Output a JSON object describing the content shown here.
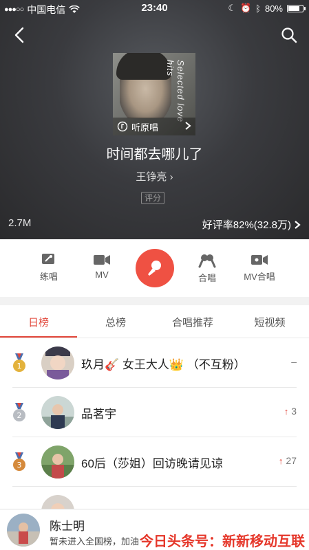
{
  "status_bar": {
    "signal": "●●●○○",
    "carrier": "中国电信",
    "time": "23:40",
    "battery": "80%"
  },
  "song": {
    "cover_caption": "听原唱",
    "cover_text": "Selected love hits",
    "title": "时间都去哪儿了",
    "artist": "王铮亮 ›",
    "rate_tag": "评分",
    "listen_count": "2.7M",
    "good_rate": "好评率82%(32.8万)"
  },
  "actions": [
    {
      "label": "练唱",
      "icon": "practice-icon"
    },
    {
      "label": "MV",
      "icon": "video-camera-icon"
    },
    {
      "label": "",
      "icon": "microphone-icon"
    },
    {
      "label": "合唱",
      "icon": "duet-icon"
    },
    {
      "label": "MV合唱",
      "icon": "mv-duet-icon"
    }
  ],
  "tabs": [
    {
      "label": "日榜",
      "active": true
    },
    {
      "label": "总榜"
    },
    {
      "label": "合唱推荐"
    },
    {
      "label": "短视频"
    }
  ],
  "ranking": [
    {
      "rank": 1,
      "name": "玖月🎸 女王大人👑 （不互粉）",
      "change": "–",
      "trend": "none"
    },
    {
      "rank": 2,
      "name": "品茗宇",
      "change": "3",
      "trend": "up"
    },
    {
      "rank": 3,
      "name": "60后（莎姐）回访晚请见谅",
      "change": "27",
      "trend": "up"
    }
  ],
  "me": {
    "name": "陈士明",
    "status": "暂未进入全国榜，加油"
  },
  "watermark": "今日头条号：新新移动互联",
  "colors": {
    "accent": "#e2463a",
    "sing_button": "#ef5143",
    "gold": "#e3b23c",
    "silver": "#b8bcc2",
    "bronze": "#d58a3c"
  }
}
